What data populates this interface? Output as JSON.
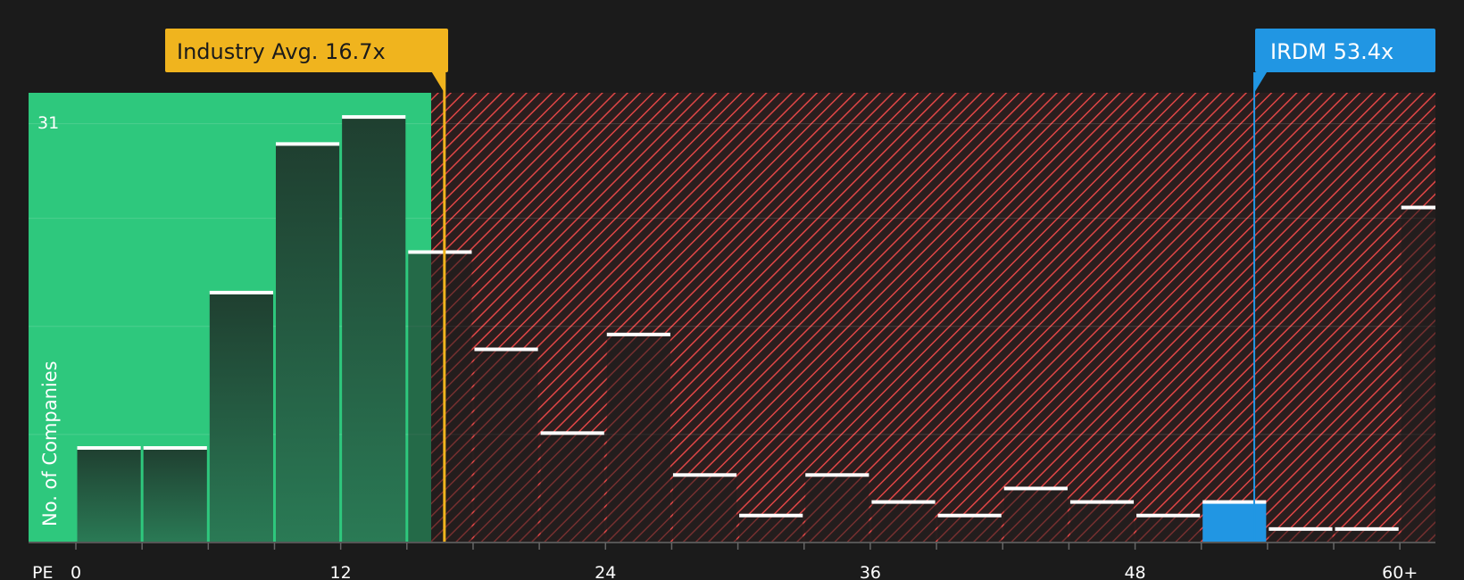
{
  "colors": {
    "background": "#1b1b1b",
    "fair_zone": "#2ec87d",
    "expensive_zone": "#e04646",
    "bar_fill": "#1e4432",
    "bar_cap": "#ffffff",
    "industry_callout": "#f0b41e",
    "company_callout": "#2196e3",
    "company_bar": "#2196e3"
  },
  "chart_data": {
    "type": "bar",
    "title": "",
    "xlabel": "PE",
    "ylabel": "No. of Companies",
    "x_range": [
      0,
      61.5
    ],
    "y_max": 32,
    "ticks": [
      {
        "value": 0,
        "label": "0"
      },
      {
        "value": 12,
        "label": "12"
      },
      {
        "value": 24,
        "label": "24"
      },
      {
        "value": 36,
        "label": "36"
      },
      {
        "value": 48,
        "label": "48"
      },
      {
        "value": 60,
        "label": "60+"
      }
    ],
    "y_tick_label": "31",
    "y_tick_value": 31,
    "gridlines": [
      8,
      16,
      24,
      31
    ],
    "bin_width": 3,
    "bins": [
      {
        "start": 0,
        "value": 7
      },
      {
        "start": 3,
        "value": 7
      },
      {
        "start": 6,
        "value": 18.5
      },
      {
        "start": 9,
        "value": 29.5
      },
      {
        "start": 12,
        "value": 31.5
      },
      {
        "start": 15,
        "value": 21.5
      },
      {
        "start": 18,
        "value": 14.3
      },
      {
        "start": 21,
        "value": 8.1
      },
      {
        "start": 24,
        "value": 15.4
      },
      {
        "start": 27,
        "value": 5
      },
      {
        "start": 30,
        "value": 2
      },
      {
        "start": 33,
        "value": 5
      },
      {
        "start": 36,
        "value": 3
      },
      {
        "start": 39,
        "value": 2
      },
      {
        "start": 42,
        "value": 4
      },
      {
        "start": 45,
        "value": 3
      },
      {
        "start": 48,
        "value": 2
      },
      {
        "start": 51,
        "value": 3,
        "highlight": true
      },
      {
        "start": 54,
        "value": 1
      },
      {
        "start": 57,
        "value": 1
      },
      {
        "start": 60,
        "value": 24.8
      }
    ],
    "fair_zone_end": 16.1,
    "industry_avg": {
      "value": 16.7,
      "label": "Industry Avg. 16.7x"
    },
    "company": {
      "value": 53.4,
      "label": "IRDM 53.4x"
    }
  }
}
